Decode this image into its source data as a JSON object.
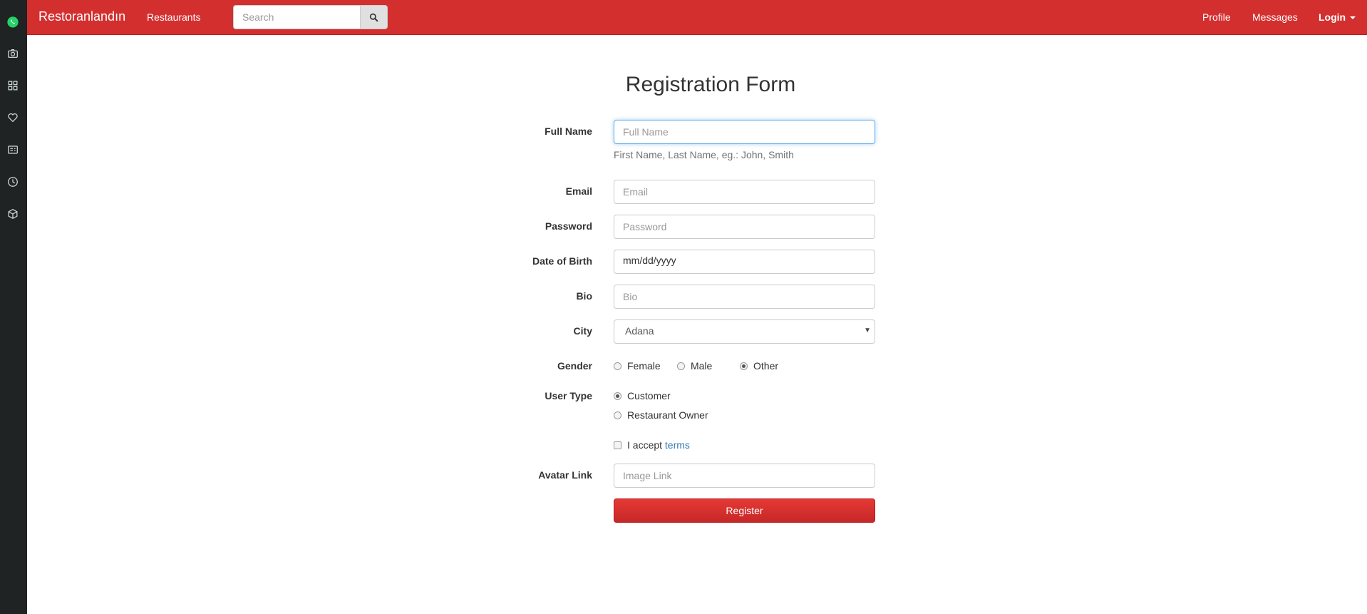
{
  "dock": {
    "icons": [
      "whatsapp-icon",
      "camera-icon",
      "grid-icon",
      "heart-icon",
      "news-icon",
      "clock-icon",
      "cube-icon"
    ]
  },
  "navbar": {
    "brand": "Restoranlandın",
    "restaurants": "Restaurants",
    "search_placeholder": "Search",
    "profile": "Profile",
    "messages": "Messages",
    "login": "Login",
    "color": "#d32f2f"
  },
  "form": {
    "title": "Registration Form",
    "full_name": {
      "label": "Full Name",
      "placeholder": "Full Name",
      "value": "",
      "help": "First Name, Last Name, eg.: John, Smith"
    },
    "email": {
      "label": "Email",
      "placeholder": "Email",
      "value": ""
    },
    "password": {
      "label": "Password",
      "placeholder": "Password",
      "value": ""
    },
    "dob": {
      "label": "Date of Birth",
      "value": "mm/dd/yyyy"
    },
    "bio": {
      "label": "Bio",
      "placeholder": "Bio",
      "value": ""
    },
    "city": {
      "label": "City",
      "selected": "Adana"
    },
    "gender": {
      "label": "Gender",
      "options": [
        "Female",
        "Male",
        "Other"
      ],
      "selected": "Other"
    },
    "user_type": {
      "label": "User Type",
      "options": [
        "Customer",
        "Restaurant Owner"
      ],
      "selected": "Customer"
    },
    "terms": {
      "prefix": "I accept",
      "link": "terms",
      "checked": false
    },
    "avatar": {
      "label": "Avatar Link",
      "placeholder": "Image Link",
      "value": ""
    },
    "submit": "Register"
  }
}
